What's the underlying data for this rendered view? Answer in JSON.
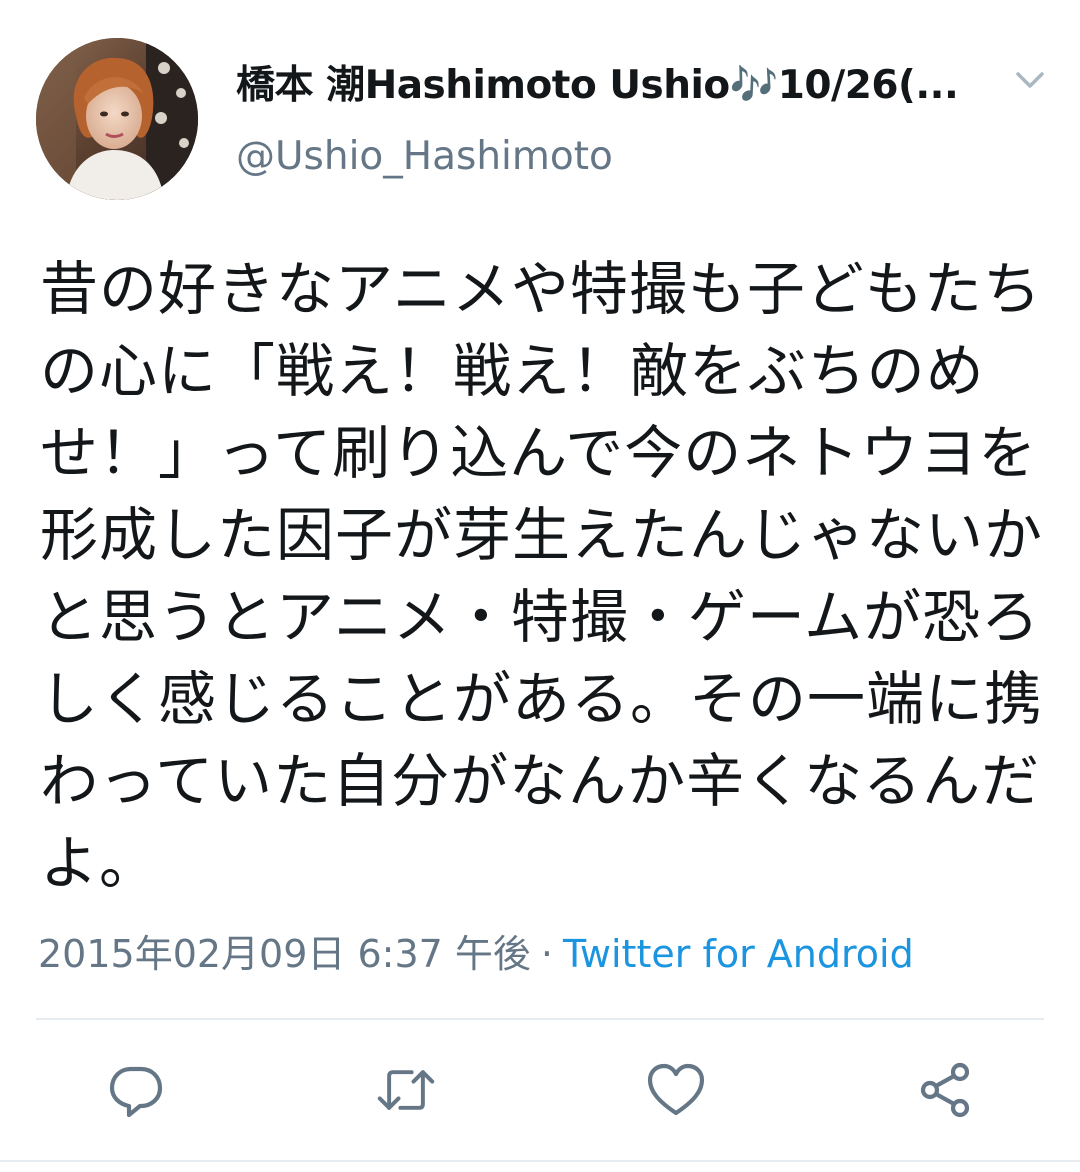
{
  "tweet": {
    "author": {
      "display_name": "橋本 潮Hashimoto Ushio",
      "display_name_emoji": "🎶",
      "display_name_suffix": "10/26(...",
      "username": "@Ushio_Hashimoto",
      "avatar_icon": "profile-photo"
    },
    "text": "昔の好きなアニメや特撮も子どもたちの心に「戦え！戦え！敵をぶちのめせ！」って刷り込んで今のネトウヨを形成した因子が芽生えたんじゃないかと思うとアニメ・特撮・ゲームが恐ろしく感じることがある。その一端に携わっていた自分がなんか辛くなるんだよ。",
    "timestamp": "2015年02月09日 6:37 午後",
    "separator": "·",
    "source": "Twitter for Android",
    "colors": {
      "text": "#14171a",
      "secondary": "#657786",
      "link": "#1b95e0",
      "divider": "#e6ecf0"
    },
    "actions": [
      {
        "icon": "reply-icon"
      },
      {
        "icon": "retweet-icon"
      },
      {
        "icon": "like-icon"
      },
      {
        "icon": "share-icon"
      }
    ],
    "menu_icon": "chevron-down-icon"
  }
}
